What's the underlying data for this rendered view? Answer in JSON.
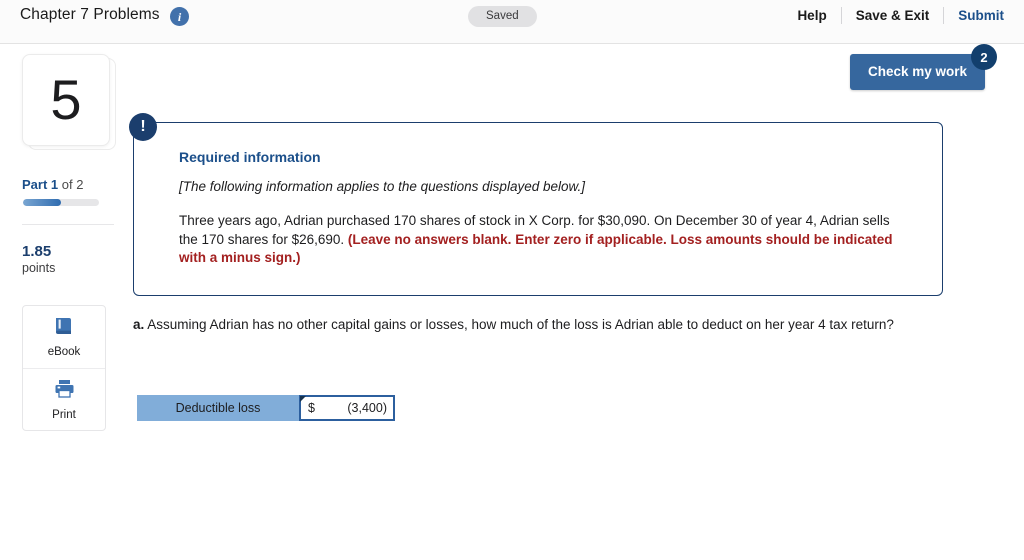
{
  "header": {
    "title": "Chapter 7 Problems",
    "info_icon": "info-icon",
    "saved_badge": "Saved",
    "links": [
      {
        "label": "Help",
        "primary": false
      },
      {
        "label": "Save & Exit",
        "primary": false
      },
      {
        "label": "Submit",
        "primary": true
      }
    ]
  },
  "check_work": {
    "label": "Check my work",
    "badge_count": "2",
    "accent": "#36679e",
    "badge_color": "#123f6d"
  },
  "sidebar": {
    "question_number": "5",
    "part_prefix": "Part ",
    "part_current": "1",
    "part_suffix": " of 2",
    "progress_percent": 50,
    "points_value": "1.85",
    "points_label": "points",
    "tools": [
      {
        "label": "eBook",
        "icon": "book-icon"
      },
      {
        "label": "Print",
        "icon": "printer-icon"
      }
    ]
  },
  "required_info": {
    "badge_icon": "exclamation-icon",
    "title": "Required information",
    "applies_note": "[The following information applies to the questions displayed below.]",
    "body_plain": "Three years ago, Adrian purchased 170 shares of stock in X Corp. for $30,090. On December 30 of year 4, Adrian sells the 170 shares for $26,690. ",
    "body_warning": "(Leave no answers blank. Enter zero if applicable. Loss amounts should be indicated with a minus sign.)",
    "warning_color": "#a32020",
    "border_color": "#1b3e6d"
  },
  "question": {
    "part_letter": "a.",
    "text": " Assuming Adrian has no other capital gains or losses, how much of the loss is Adrian able to deduct on her year 4 tax return?"
  },
  "answer_table": {
    "row_label": "Deductible loss",
    "currency_symbol": "$",
    "value": "(3,400)",
    "label_bg": "#81add9",
    "input_border": "#2c5f9e"
  }
}
